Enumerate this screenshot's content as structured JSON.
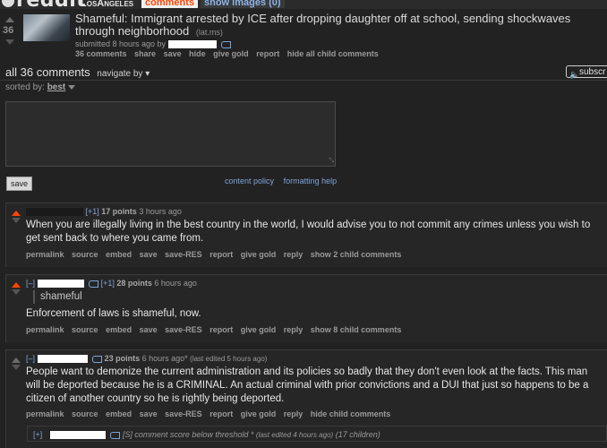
{
  "header": {
    "site": "reddit",
    "subreddit": "LosAngeles",
    "tabs": [
      "comments",
      "show images (0)"
    ]
  },
  "post": {
    "score": "36",
    "title": "Shameful: Immigrant arrested by ICE after dropping daughter off at school, sending shockwaves through neighborhood",
    "domain": "(lat.ms)",
    "meta": "submitted 8 hours ago by",
    "links": [
      "36 comments",
      "share",
      "save",
      "hide",
      "give gold",
      "report",
      "hide all child comments"
    ]
  },
  "comments_header": {
    "title": "all 36 comments",
    "navigate": "navigate by",
    "subscribe": "subscr",
    "sorted_label": "sorted by:",
    "sorted_value": "best"
  },
  "reply": {
    "save": "save",
    "content_policy": "content policy",
    "formatting_help": "formatting help"
  },
  "comments": [
    {
      "expand": "[+1]",
      "points": "17 points",
      "time": "3 hours ago",
      "body": "When you are illegally living in the best country in the world, I would advise you to not commit any crimes unless you wish to get sent back to where you came from.",
      "links": [
        "permalink",
        "source",
        "embed",
        "save",
        "save-RES",
        "report",
        "give gold",
        "reply",
        "show 2 child comments"
      ]
    },
    {
      "collapse": "[–]",
      "expand": "[+1]",
      "points": "28 points",
      "time": "6 hours ago",
      "quote": "shameful",
      "body": "Enforcement of laws is shameful, now.",
      "links": [
        "permalink",
        "source",
        "embed",
        "save",
        "save-RES",
        "report",
        "give gold",
        "reply",
        "show 8 child comments"
      ]
    },
    {
      "collapse": "[–]",
      "points": "23 points",
      "time": "6 hours ago*",
      "edited": "(last edited 5 hours ago)",
      "body": "People want to demonize the current administration and its policies so badly that they don't even look at the facts. This man will be deported because he is a CRIMINAL. An actual criminal with prior convictions and a DUI that just so happens to be a citizen of another country so he is rightly being deported.",
      "links": [
        "permalink",
        "source",
        "embed",
        "save",
        "save-RES",
        "report",
        "give gold",
        "reply",
        "hide child comments"
      ]
    }
  ],
  "collapsed_comment": {
    "expand": "[+]",
    "text": "[S] comment score below threshold *",
    "edited": "(last edited 4 hours ago)",
    "children": "(17 children)"
  }
}
